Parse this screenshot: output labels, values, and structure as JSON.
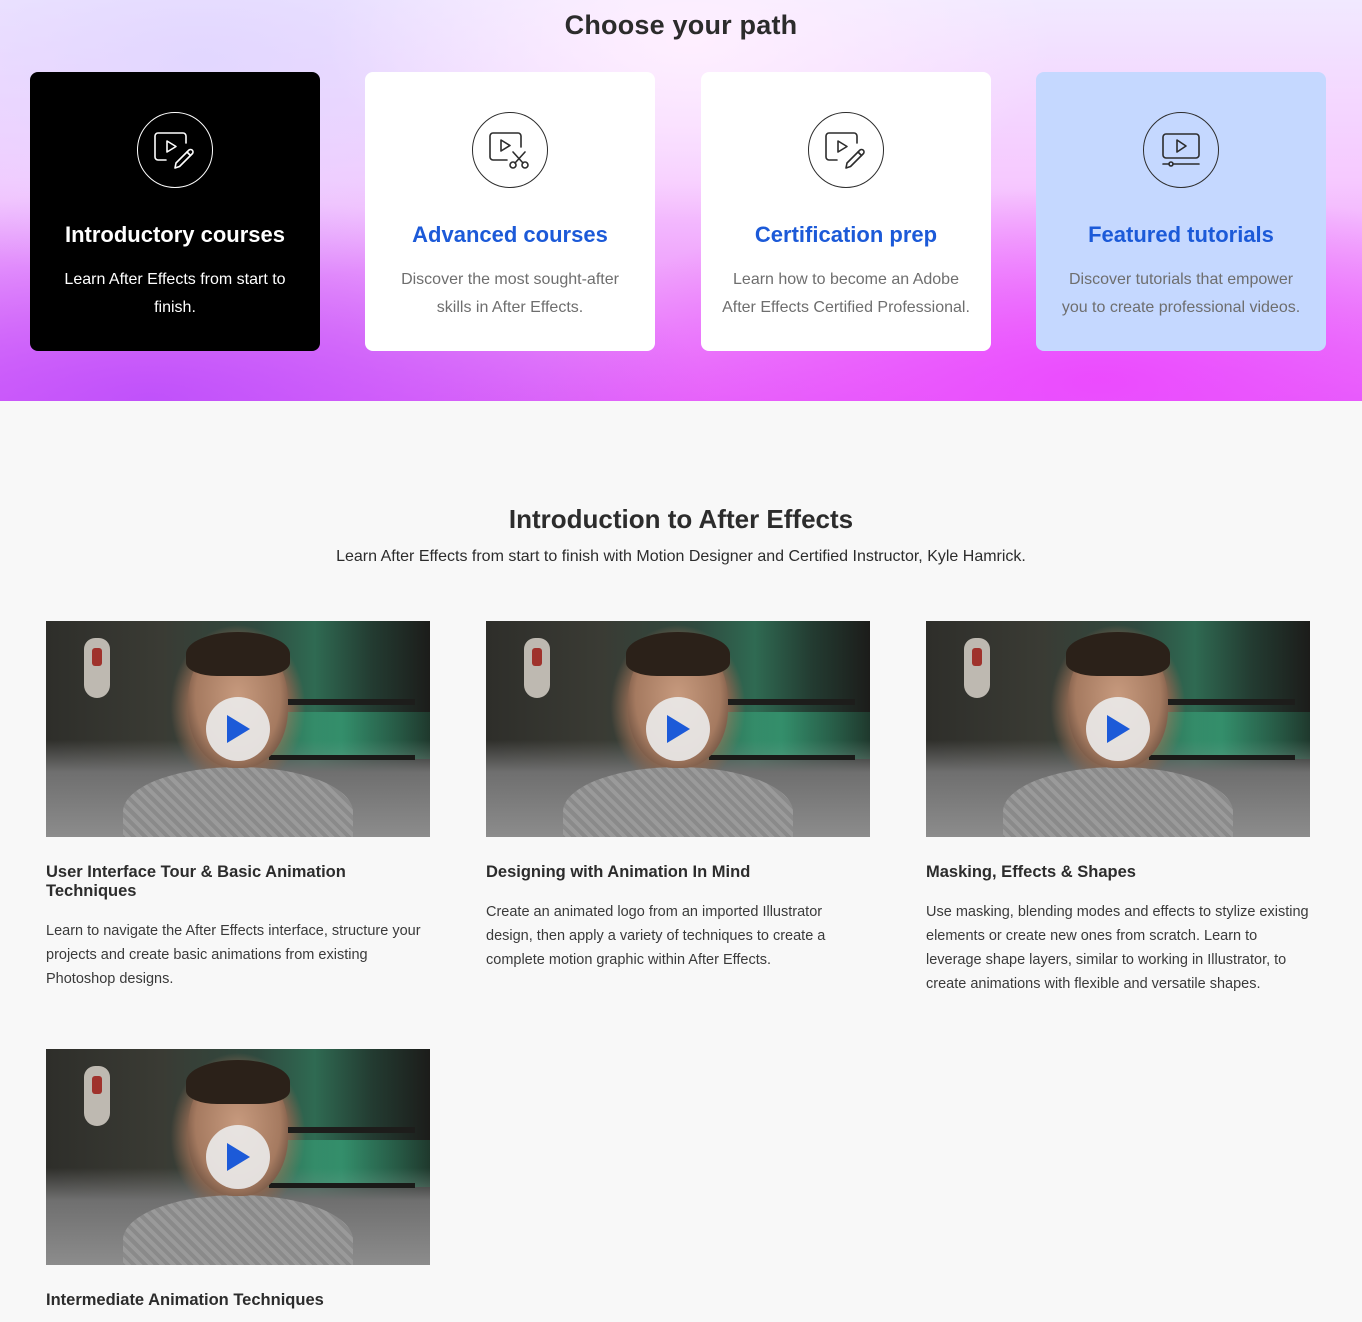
{
  "hero": {
    "title": "Choose your path",
    "cards": [
      {
        "title": "Introductory courses",
        "desc": "Learn After Effects from start to finish.",
        "icon": "video-edit-icon"
      },
      {
        "title": "Advanced courses",
        "desc": "Discover the most sought-after skills in After Effects.",
        "icon": "video-cut-icon"
      },
      {
        "title": "Certification prep",
        "desc": "Learn how to become an Adobe After Effects Certified Professional.",
        "icon": "video-edit-icon"
      },
      {
        "title": "Featured tutorials",
        "desc": "Discover tutorials that empower you to create professional videos.",
        "icon": "video-tutorial-icon"
      }
    ]
  },
  "intro": {
    "title": "Introduction to After Effects",
    "subtitle": "Learn After Effects from start to finish with Motion Designer and Certified Instructor, Kyle Hamrick.",
    "videos": [
      {
        "title": "User Interface Tour & Basic Animation Techniques",
        "desc": "Learn to navigate the After Effects interface, structure your projects and create basic animations from existing Photoshop designs."
      },
      {
        "title": "Designing with Animation In Mind",
        "desc": "Create an animated logo from an imported Illustrator design, then apply a variety of techniques to create a complete motion graphic within After Effects."
      },
      {
        "title": "Masking, Effects & Shapes",
        "desc": "Use masking, blending modes and effects to stylize existing elements or create new ones from scratch. Learn to leverage shape layers, similar to working in Illustrator, to create animations with flexible and versatile shapes."
      },
      {
        "title": "Intermediate Animation Techniques",
        "desc": ""
      }
    ]
  },
  "colors": {
    "accent": "#1c5ad8",
    "play": "#1c5ad8"
  }
}
